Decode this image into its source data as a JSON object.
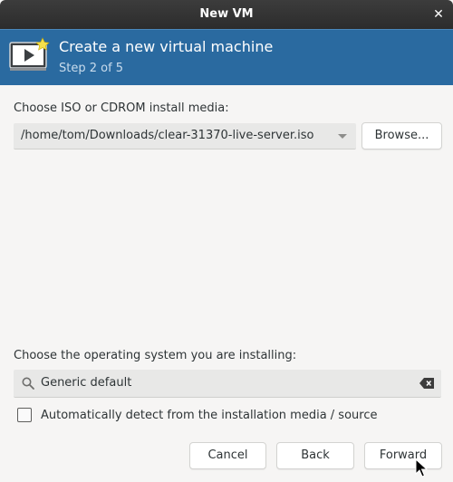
{
  "window": {
    "title": "New VM",
    "close_glyph": "✕"
  },
  "header": {
    "icon": "vm-monitor-icon",
    "heading": "Create a new virtual machine",
    "step": "Step 2 of 5",
    "background": "#2a6aa0"
  },
  "install_media": {
    "label": "Choose ISO or CDROM install media:",
    "selected_value": "/home/tom/Downloads/clear-31370-live-server.iso",
    "browse_label": "Browse..."
  },
  "os_selection": {
    "label": "Choose the operating system you are installing:",
    "search_value": "Generic default",
    "search_icon": "search-icon",
    "clear_icon": "clear-text-icon"
  },
  "auto_detect": {
    "checked": false,
    "label": "Automatically detect from the installation media / source"
  },
  "footer": {
    "cancel_label": "Cancel",
    "back_label": "Back",
    "forward_label": "Forward"
  }
}
